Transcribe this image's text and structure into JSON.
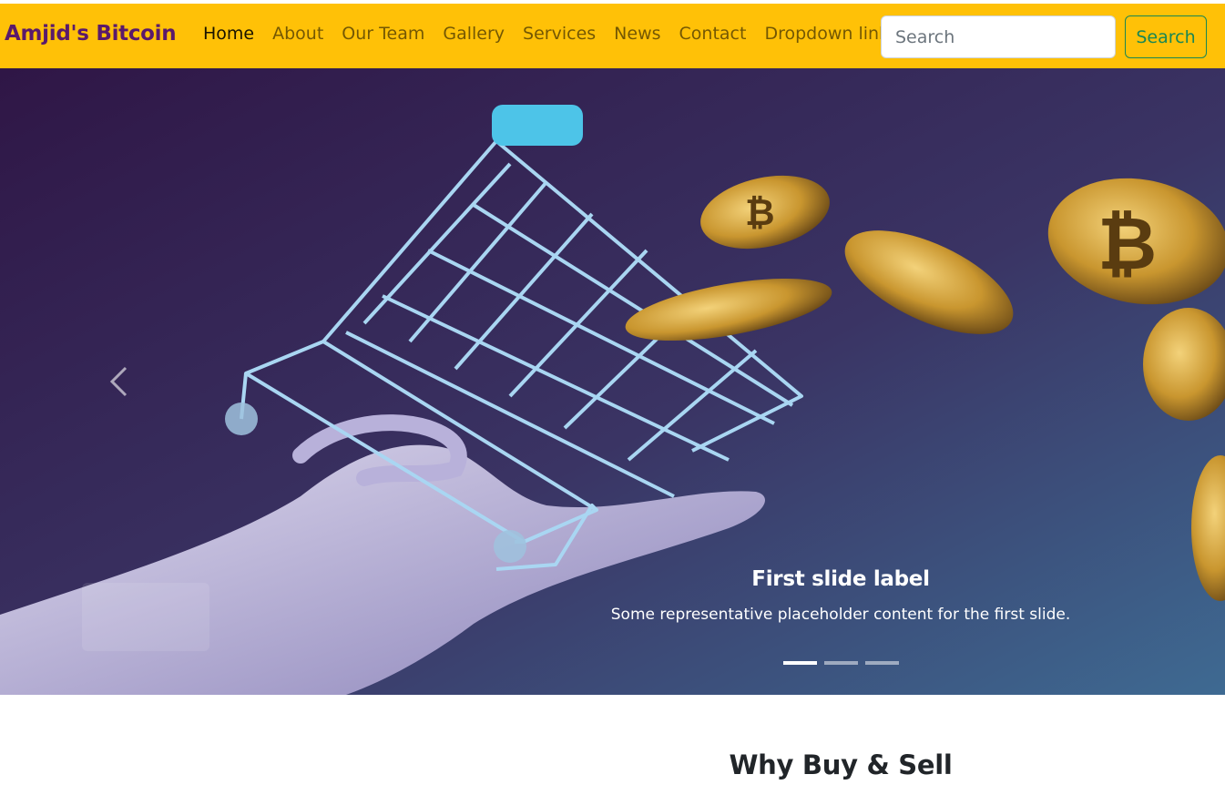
{
  "navbar": {
    "brand": "Amjid's Bitcoin",
    "links": [
      {
        "label": "Home",
        "active": true
      },
      {
        "label": "About"
      },
      {
        "label": "Our Team"
      },
      {
        "label": "Gallery"
      },
      {
        "label": "Services"
      },
      {
        "label": "News"
      },
      {
        "label": "Contact"
      },
      {
        "label": "Dropdown link",
        "dropdown": true
      }
    ],
    "search": {
      "placeholder": "Search",
      "button_label": "Search"
    },
    "colors": {
      "bar": "#ffc107",
      "brand": "#5a1a6b",
      "search_button": "#198754"
    }
  },
  "carousel": {
    "slide": {
      "title": "First slide label",
      "text": "Some representative placeholder content for the first slide."
    },
    "indicators": [
      {
        "active": true
      },
      {
        "active": false
      },
      {
        "active": false
      }
    ],
    "prev_icon": "chevron-left-icon",
    "image_subject": "shopping-cart-with-bitcoins-on-hand"
  },
  "section": {
    "title": "Why Buy & Sell"
  }
}
